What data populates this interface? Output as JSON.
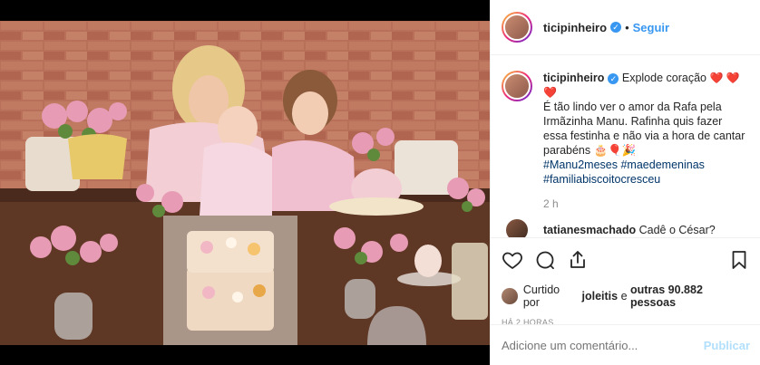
{
  "post": {
    "username": "ticipinheiro",
    "follow_label": "Seguir",
    "separator": "•",
    "more_label": "•••",
    "caption_lines": [
      "Explode coração",
      "É tão lindo ver o amor da Rafa pela Irmãzinha Manu. Rafinha quis fazer essa festinha e não via a hora de cantar parabéns"
    ],
    "hashtags": [
      "#Manu2meses",
      "#maedemeninas",
      "#familiabiscoitocresceu"
    ],
    "caption_age": "2 h",
    "comment": {
      "username": "tatianesmachado",
      "text": "Cadê o César?"
    },
    "likes": {
      "prefix": "Curtido por",
      "user": "joleitis",
      "connector": "e",
      "others": "outras 90.882 pessoas"
    },
    "posted_ago": "HÁ 2 HORAS",
    "comment_placeholder": "Adicione um comentário...",
    "publish_label": "Publicar"
  },
  "colors": {
    "accent": "#3897f0",
    "hashtag": "#003569",
    "heart_emoji": "#d8202e",
    "publish_disabled": "#b2dffc"
  },
  "icons": [
    "verified-icon",
    "more-options-icon",
    "heart-icon",
    "comment-icon",
    "share-icon",
    "bookmark-icon",
    "avatar"
  ]
}
